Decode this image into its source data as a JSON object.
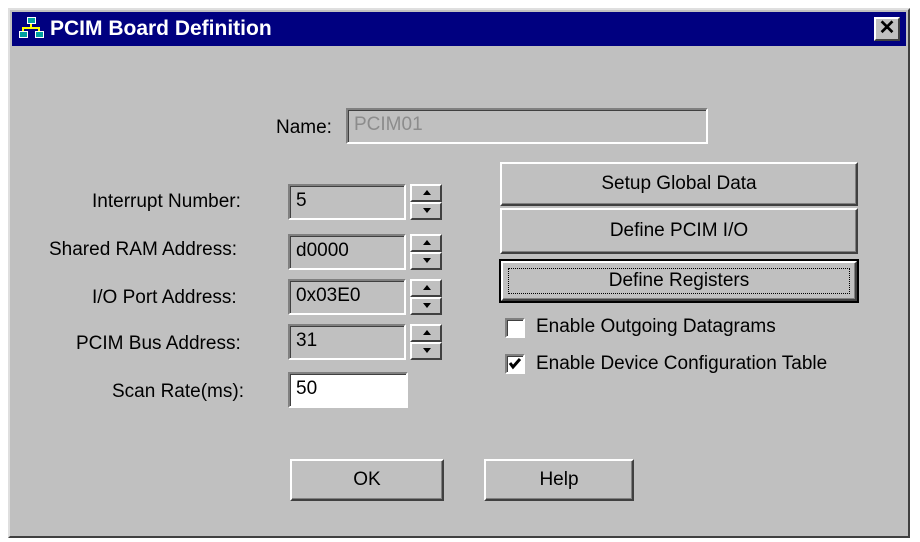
{
  "window": {
    "title": "PCIM Board Definition",
    "close_glyph": "✕"
  },
  "name_field": {
    "label": "Name:",
    "value": "PCIM01"
  },
  "fields": {
    "interrupt": {
      "label": "Interrupt Number:",
      "value": "5"
    },
    "shared_ram": {
      "label": "Shared RAM Address:",
      "value": "d0000"
    },
    "io_port": {
      "label": "I/O Port Address:",
      "value": "0x03E0"
    },
    "bus_address": {
      "label": "PCIM Bus Address:",
      "value": "31"
    },
    "scan_rate": {
      "label": "Scan Rate(ms):",
      "value": "50"
    }
  },
  "buttons": {
    "setup_global": "Setup Global Data",
    "define_io": "Define PCIM I/O",
    "define_registers": "Define Registers",
    "ok": "OK",
    "help": "Help"
  },
  "checkboxes": {
    "outgoing": {
      "label": "Enable Outgoing Datagrams",
      "checked": false
    },
    "device_config": {
      "label": "Enable Device Configuration Table",
      "checked": true
    }
  },
  "icons": {
    "title": "network-icon",
    "spin": "spin-arrows-icon",
    "close": "close-icon"
  }
}
